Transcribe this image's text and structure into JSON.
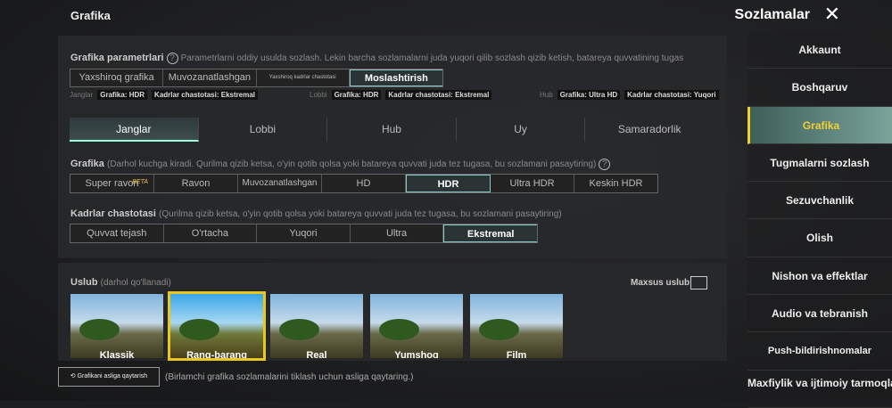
{
  "header": {
    "title": "Grafika",
    "section": "Sozlamalar"
  },
  "params": {
    "label": "Grafika parametrlari",
    "hint": "Parametrlarni oddiy usulda sozlash. Lekin barcha sozlamalarni juda yuqori qilib sozlash qizib ketish, batareya quvvatining tugas",
    "presets": [
      "Yaxshiroq grafika",
      "Muvozanatlashgan",
      "Yaxshiroq kadrlar chastotasi",
      "Moslashtirish"
    ],
    "summary": [
      {
        "name": "Janglar",
        "graphics": "Grafika: HDR",
        "fps": "Kadrlar chastotasi: Ekstremal"
      },
      {
        "name": "Lobbi",
        "graphics": "Grafika: HDR",
        "fps": "Kadrlar chastotasi: Ekstremal"
      },
      {
        "name": "Hub",
        "graphics": "Grafika: Ultra HD",
        "fps": "Kadrlar chastotasi: Yuqori"
      }
    ]
  },
  "tabs": [
    "Janglar",
    "Lobbi",
    "Hub",
    "Uy",
    "Samaradorlik"
  ],
  "graphics": {
    "label": "Grafika",
    "hint": "(Darhol kuchga kiradi. Qurilma qizib ketsa, o'yin qotib qolsa yoki batareya quvvati juda tez tugasa, bu sozlamani pasaytiring)",
    "options": [
      "Super ravon",
      "Ravon",
      "Muvozanatlashgan",
      "HD",
      "HDR",
      "Ultra HDR",
      "Keskin HDR"
    ],
    "beta": "BETA"
  },
  "fps": {
    "label": "Kadrlar chastotasi",
    "hint": "(Qurilma qizib ketsa, o'yin qotib qolsa yoki batareya quvvati juda tez tugasa, bu sozlamani pasaytiring)",
    "options": [
      "Quvvat tejash",
      "O'rtacha",
      "Yuqori",
      "Ultra",
      "Ekstremal"
    ]
  },
  "style": {
    "label": "Uslub",
    "hint": "(darhol qo'llanadi)",
    "custom": "Maxsus uslub",
    "options": [
      "Klassik",
      "Rang-barang",
      "Real",
      "Yumshoq",
      "Film"
    ]
  },
  "reset": {
    "button": "⟲ Grafikani asliga qaytarish",
    "hint": "(Birlamchi grafika sozlamalarini tiklash uchun asliga qaytaring.)"
  },
  "sidebar": [
    "Akkaunt",
    "Boshqaruv",
    "Grafika",
    "Tugmalarni sozlash",
    "Sezuvchanlik",
    "Olish",
    "Nishon va effektlar",
    "Audio va tebranish",
    "Push-bildirishnomalar",
    "Maxfiylik va ijtimoiy tarmoqlar"
  ]
}
